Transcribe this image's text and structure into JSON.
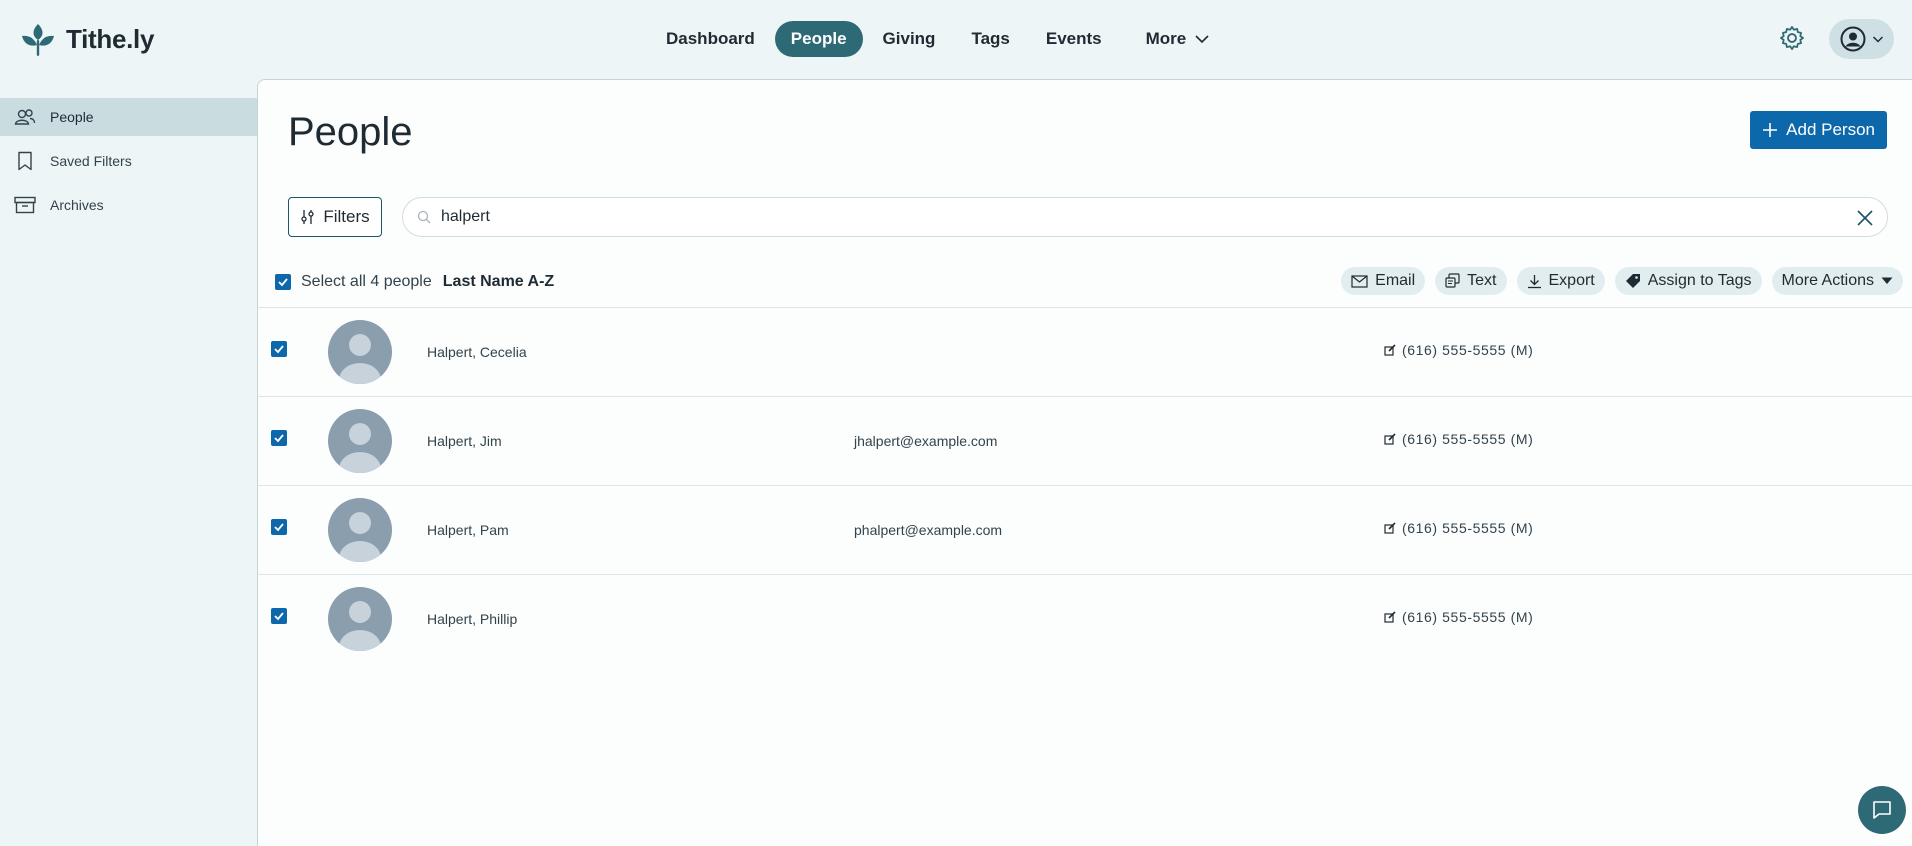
{
  "brand": {
    "name": "Tithe.ly"
  },
  "nav": [
    {
      "label": "Dashboard"
    },
    {
      "label": "People",
      "active": true
    },
    {
      "label": "Giving"
    },
    {
      "label": "Tags"
    },
    {
      "label": "Events"
    },
    {
      "label": "More"
    }
  ],
  "sidebar": {
    "items": [
      {
        "label": "People",
        "icon": "people-icon",
        "active": true
      },
      {
        "label": "Saved Filters",
        "icon": "bookmark-icon"
      },
      {
        "label": "Archives",
        "icon": "archive-box-icon"
      }
    ]
  },
  "main": {
    "title": "People",
    "add_button": "Add Person",
    "filters_button": "Filters",
    "search_value": "halpert",
    "select_all_label": "Select all 4 people",
    "sort_label": "Last Name A-Z",
    "actions": [
      {
        "label": "Email",
        "icon": "envelope-icon"
      },
      {
        "label": "Text",
        "icon": "chat-text-icon"
      },
      {
        "label": "Export",
        "icon": "download-icon"
      },
      {
        "label": "Assign to Tags",
        "icon": "tag-icon"
      },
      {
        "label": "More Actions",
        "icon": "caret-down-icon"
      }
    ],
    "people": [
      {
        "name": "Halpert, Cecelia",
        "email": "",
        "phone": "(616) 555-5555 (M)",
        "checked": true
      },
      {
        "name": "Halpert, Jim",
        "email": "jhalpert@example.com",
        "phone": "(616) 555-5555 (M)",
        "checked": true
      },
      {
        "name": "Halpert, Pam",
        "email": "phalpert@example.com",
        "phone": "(616) 555-5555 (M)",
        "checked": true
      },
      {
        "name": "Halpert, Phillip",
        "email": "",
        "phone": "(616) 555-5555 (M)",
        "checked": true
      }
    ]
  },
  "colors": {
    "accent": "#2e6a76",
    "primary": "#0c68ab",
    "background": "#eef5f6"
  }
}
